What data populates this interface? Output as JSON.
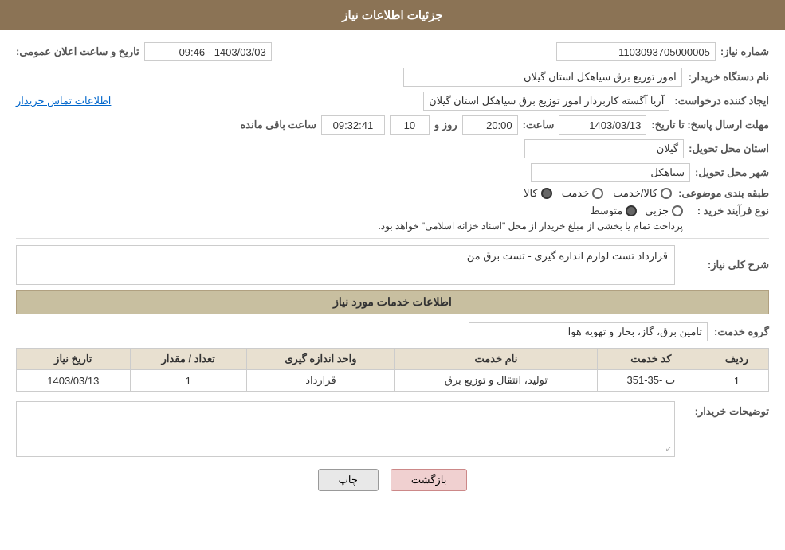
{
  "page": {
    "title": "جزئیات اطلاعات نیاز"
  },
  "header": {
    "label": "جزئیات اطلاعات نیاز"
  },
  "fields": {
    "need_number_label": "شماره نیاز:",
    "need_number_value": "1103093705000005",
    "date_announce_label": "تاریخ و ساعت اعلان عمومی:",
    "date_announce_value": "1403/03/03 - 09:46",
    "buyer_org_label": "نام دستگاه خریدار:",
    "buyer_org_value": "امور توزیع برق سیاهکل استان گیلان",
    "requester_label": "ایجاد کننده درخواست:",
    "requester_value": "آریا آگسته کاربردار امور توزیع برق سیاهکل استان گیلان",
    "contact_link": "اطلاعات تماس خریدار",
    "response_deadline_label": "مهلت ارسال پاسخ: تا تاریخ:",
    "response_date_value": "1403/03/13",
    "response_time_label": "ساعت:",
    "response_time_value": "20:00",
    "days_label": "روز و",
    "days_value": "10",
    "remaining_label": "ساعت باقی مانده",
    "remaining_time": "09:32:41",
    "province_label": "استان محل تحویل:",
    "province_value": "گیلان",
    "city_label": "شهر محل تحویل:",
    "city_value": "سیاهکل",
    "category_label": "طبقه بندی موضوعی:",
    "category_options": [
      "کالا",
      "خدمت",
      "کالا/خدمت"
    ],
    "category_selected": "کالا",
    "process_type_label": "نوع فرآیند خرید :",
    "process_options": [
      "جزیی",
      "متوسط"
    ],
    "process_selected": "متوسط",
    "process_note": "پرداخت تمام یا بخشی از مبلغ خریدار از محل \"اسناد خزانه اسلامی\" خواهد بود.",
    "need_description_label": "شرح کلی نیاز:",
    "need_description_value": "قرارداد تست لوازم اندازه گیری - تست برق من",
    "services_section": "اطلاعات خدمات مورد نیاز",
    "service_group_label": "گروه خدمت:",
    "service_group_value": "تامین برق، گاز، بخار و تهویه هوا",
    "table": {
      "headers": [
        "ردیف",
        "کد خدمت",
        "نام خدمت",
        "واحد اندازه گیری",
        "تعداد / مقدار",
        "تاریخ نیاز"
      ],
      "rows": [
        {
          "row": "1",
          "service_code": "ت -35-351",
          "service_name": "تولید، انتقال و توزیع برق",
          "unit": "قرارداد",
          "quantity": "1",
          "date": "1403/03/13"
        }
      ]
    },
    "buyer_desc_label": "توضیحات خریدار:",
    "buyer_desc_value": ""
  },
  "buttons": {
    "print_label": "چاپ",
    "back_label": "بازگشت"
  }
}
